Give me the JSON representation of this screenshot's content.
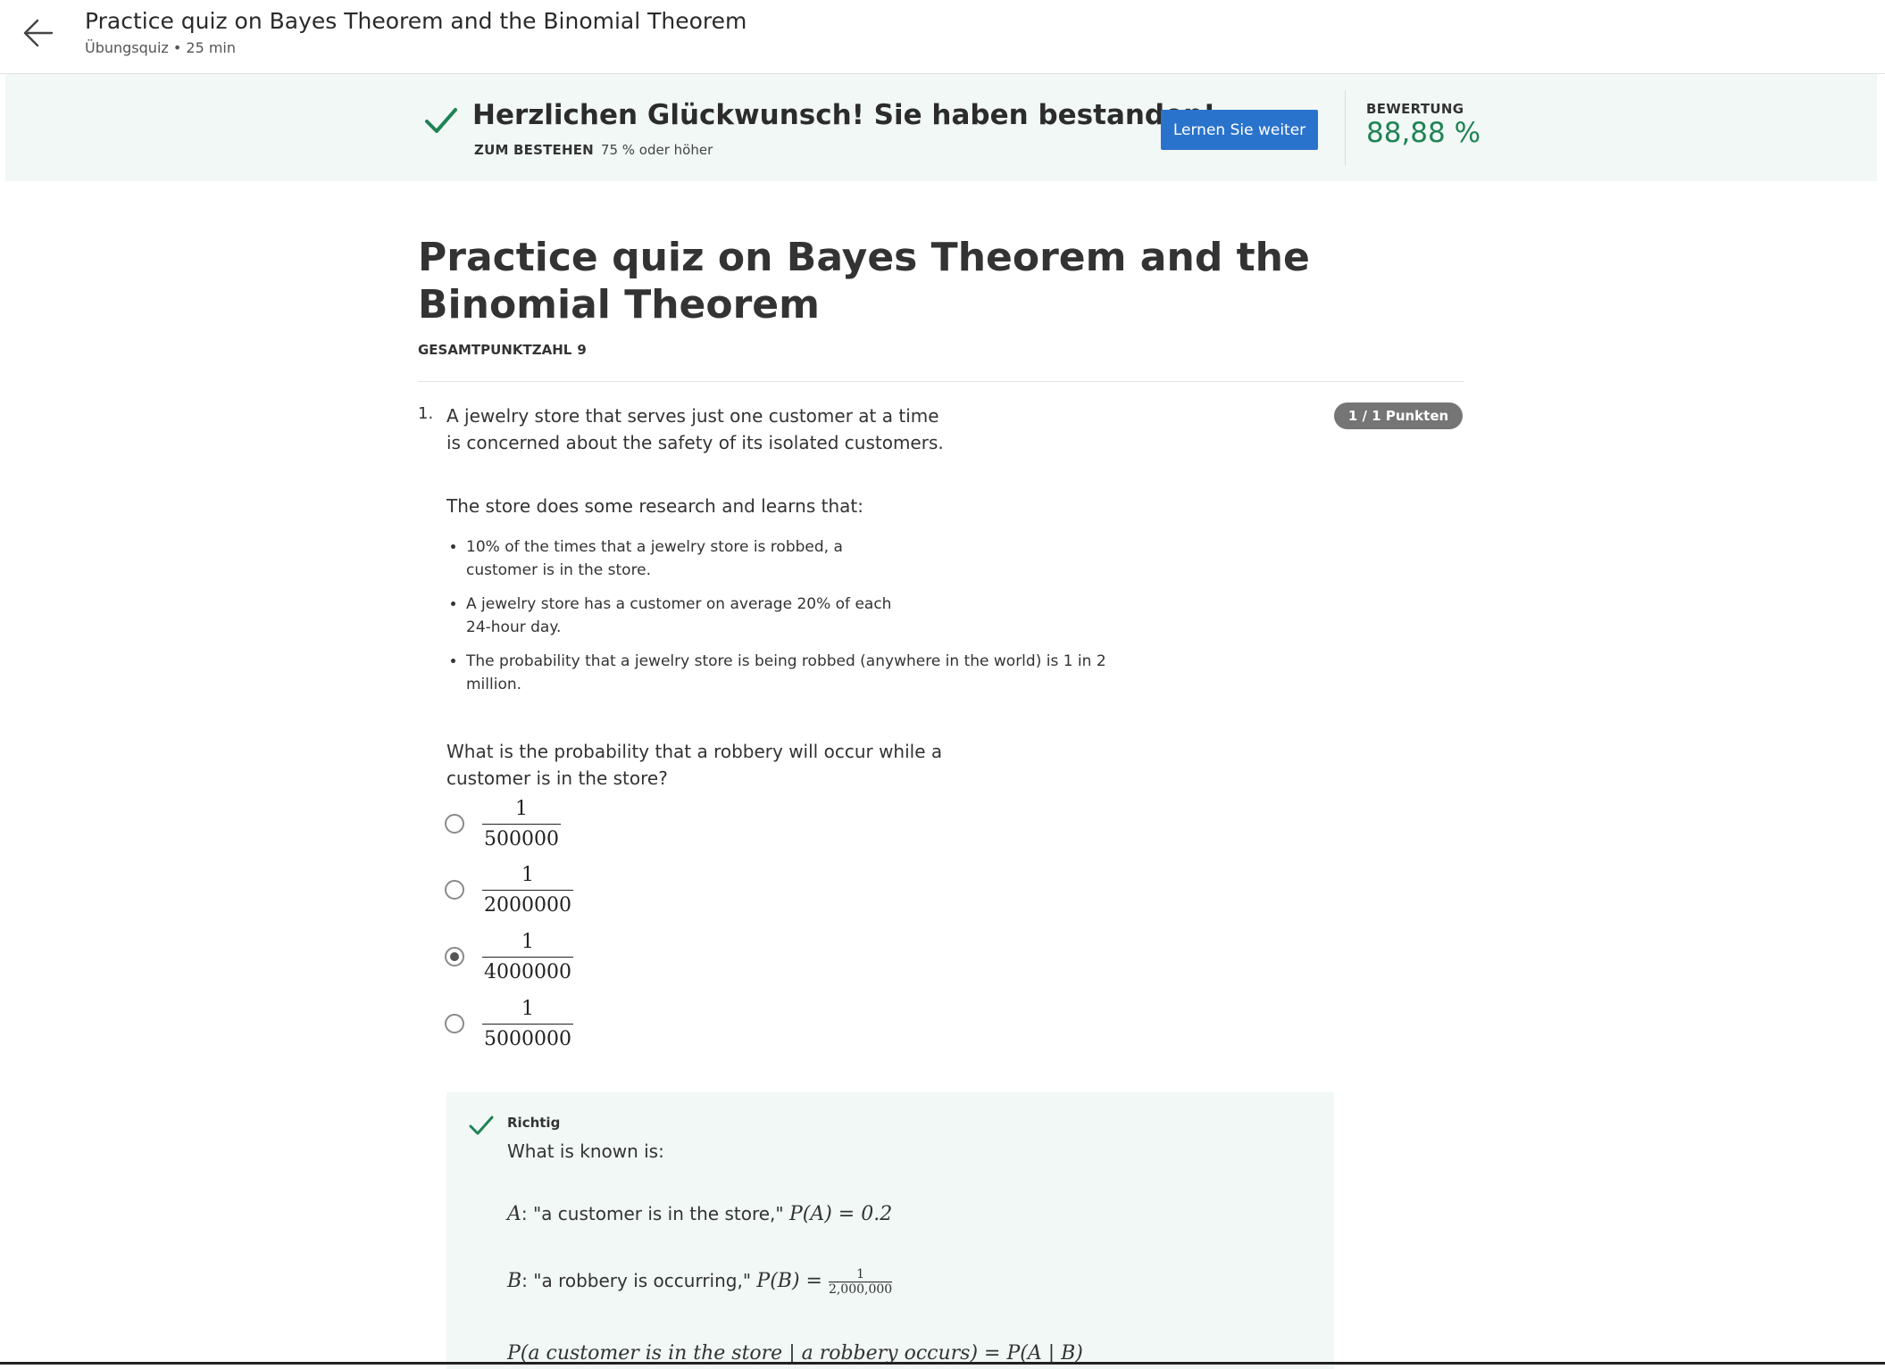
{
  "header": {
    "title": "Practice quiz on Bayes Theorem and the Binomial Theorem",
    "subtitle": "Übungsquiz • 25 min"
  },
  "banner": {
    "message": "Herzlichen Glückwunsch! Sie haben bestanden!",
    "pass_label": "ZUM BESTEHEN",
    "pass_value": "75 % oder höher",
    "continue_label": "Lernen Sie weiter",
    "grade_label": "BEWERTUNG",
    "grade_value": "88,88 %",
    "accent_color": "#1f8354",
    "button_color": "#2a73cc"
  },
  "quiz": {
    "title": "Practice quiz on Bayes Theorem and the Binomial Theorem",
    "total_points_label": "GESAMTPUNKTZAHL",
    "total_points_value": "9"
  },
  "question1": {
    "number": "1.",
    "text": "A jewelry store that serves just one customer at a time is concerned about the safety of its isolated customers.",
    "points": "1 / 1 Punkten",
    "research_intro": "The store does some research and learns that:",
    "facts": [
      "10% of the times that a jewelry store is robbed, a customer is in the store.",
      "A jewelry store has a customer on average 20% of each 24-hour day.",
      "The probability that a jewelry store is being robbed (anywhere in the world) is 1 in 2 million."
    ],
    "prompt": "What is the probability that a robbery will occur while a customer is in the store?",
    "options": [
      {
        "numerator": "1",
        "denominator": "500000",
        "selected": false
      },
      {
        "numerator": "1",
        "denominator": "2000000",
        "selected": false
      },
      {
        "numerator": "1",
        "denominator": "4000000",
        "selected": true
      },
      {
        "numerator": "1",
        "denominator": "5000000",
        "selected": false
      }
    ],
    "feedback": {
      "label": "Richtig",
      "known": "What is known is:",
      "line_a_var": "A",
      "line_a_text": ": \"a customer is in the store,\" ",
      "line_a_math": "P(A) = 0.2",
      "line_b_var": "B",
      "line_b_text": ": \"a robbery is occurring,\" ",
      "line_b_math": "P(B) = ",
      "line_b_num": "1",
      "line_b_den": "2,000,000",
      "line_c_math": "P(a customer is in the store | a robbery occurs) = P(A | B)"
    }
  }
}
